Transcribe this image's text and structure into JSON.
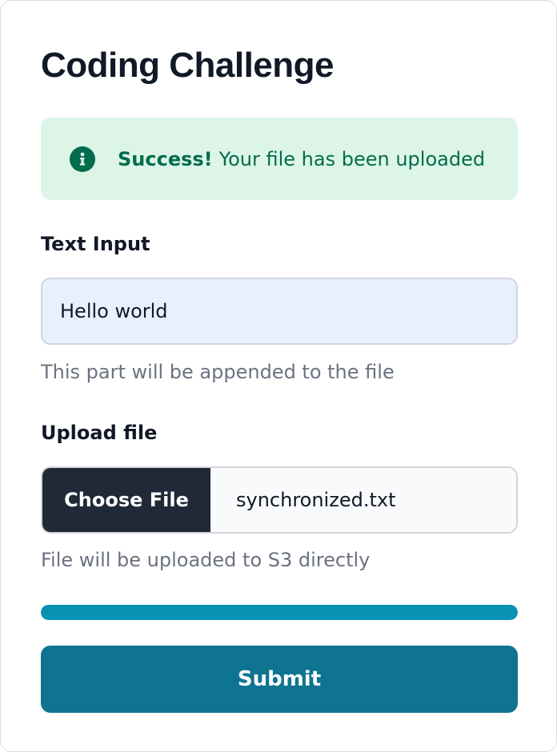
{
  "page": {
    "title": "Coding Challenge"
  },
  "alert": {
    "icon": "info-icon",
    "strong": "Success!",
    "message": "Your file has been uploaded",
    "color": "#046c4e",
    "background": "#dcf5e7"
  },
  "text_input": {
    "label": "Text Input",
    "value": "Hello world",
    "help": "This part will be appended to the file"
  },
  "upload": {
    "label": "Upload file",
    "button_label": "Choose File",
    "file_name": "synchronized.txt",
    "help": "File will be uploaded to S3 directly"
  },
  "progress": {
    "percent": 100,
    "color": "#0891b2"
  },
  "submit": {
    "label": "Submit",
    "color": "#0e7490"
  }
}
